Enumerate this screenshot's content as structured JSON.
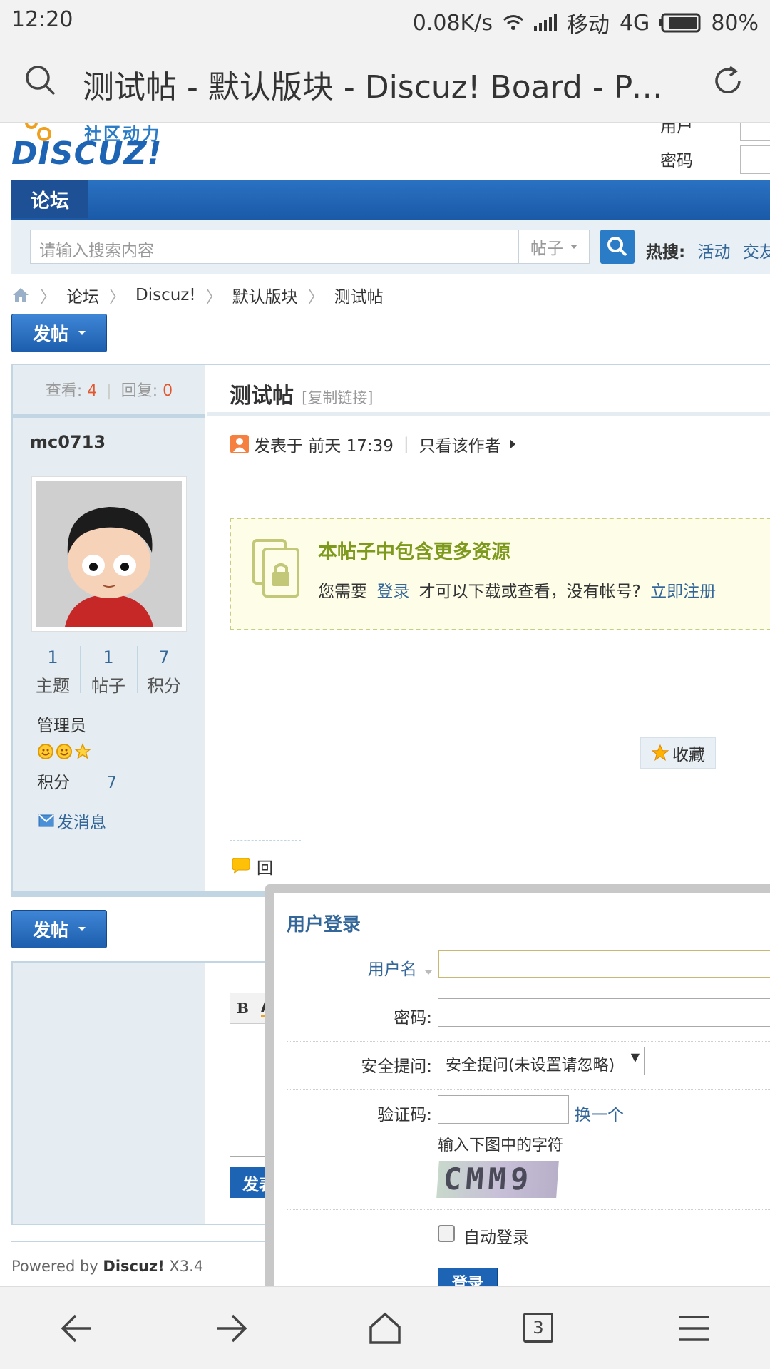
{
  "status_bar": {
    "time": "12:20",
    "speed": "0.08K/s",
    "carrier": "移动",
    "network": "4G",
    "battery": "80%"
  },
  "browser": {
    "title": "测试帖 - 默认版块 - Discuz! Board - Pow…",
    "tabs_count": "3"
  },
  "header": {
    "logo_tagline": "社区动力",
    "logo_text": "DISCUZ!",
    "username_label": "用户",
    "password_label": "密码"
  },
  "nav": {
    "forum_tab": "论坛"
  },
  "search": {
    "placeholder": "请输入搜索内容",
    "type": "帖子",
    "hot_label": "热搜:",
    "hot_items": [
      "活动",
      "交友"
    ]
  },
  "breadcrumb": [
    "论坛",
    "Discuz!",
    "默认版块",
    "测试帖"
  ],
  "post_button": "发帖",
  "thread": {
    "views_label": "查看:",
    "views": "4",
    "replies_label": "回复:",
    "replies": "0",
    "title": "测试帖",
    "copy_link": "[复制链接]",
    "posted_at": "发表于 前天 17:39",
    "only_author": "只看该作者"
  },
  "author": {
    "name": "mc0713",
    "stats": [
      {
        "value": "1",
        "label": "主题"
      },
      {
        "value": "1",
        "label": "帖子"
      },
      {
        "value": "7",
        "label": "积分"
      }
    ],
    "group": "管理员",
    "credit_label": "积分",
    "credit_value": "7",
    "send_message": "发消息"
  },
  "locked": {
    "heading": "本帖子中包含更多资源",
    "text_before": "您需要",
    "login_link": "登录",
    "text_middle": "才可以下载或查看，没有帐号?",
    "register_link": "立即注册"
  },
  "favorite": "收藏",
  "reply_partial": "回",
  "editor": {
    "bold": "B",
    "font_color": "A",
    "submit_partial": "发表"
  },
  "login_dialog": {
    "title": "用户登录",
    "username_label": "用户名",
    "password_label": "密码:",
    "question_label": "安全提问:",
    "question_value": "安全提问(未设置请忽略)",
    "captcha_label": "验证码:",
    "captcha_refresh": "换一个",
    "captcha_hint": "输入下图中的字符",
    "captcha_image_text": "CMM9",
    "remember_label": "自动登录",
    "submit": "登录"
  },
  "footer": {
    "powered_prefix": "Powered by ",
    "powered_brand": "Discuz!",
    "version": " X3.4"
  },
  "colors": {
    "nav_blue": "#1a5aa8",
    "link_blue": "#336699",
    "count_orange": "#e4572e",
    "locked_green": "#7e9a1c",
    "locked_bg": "#fdfde8"
  }
}
